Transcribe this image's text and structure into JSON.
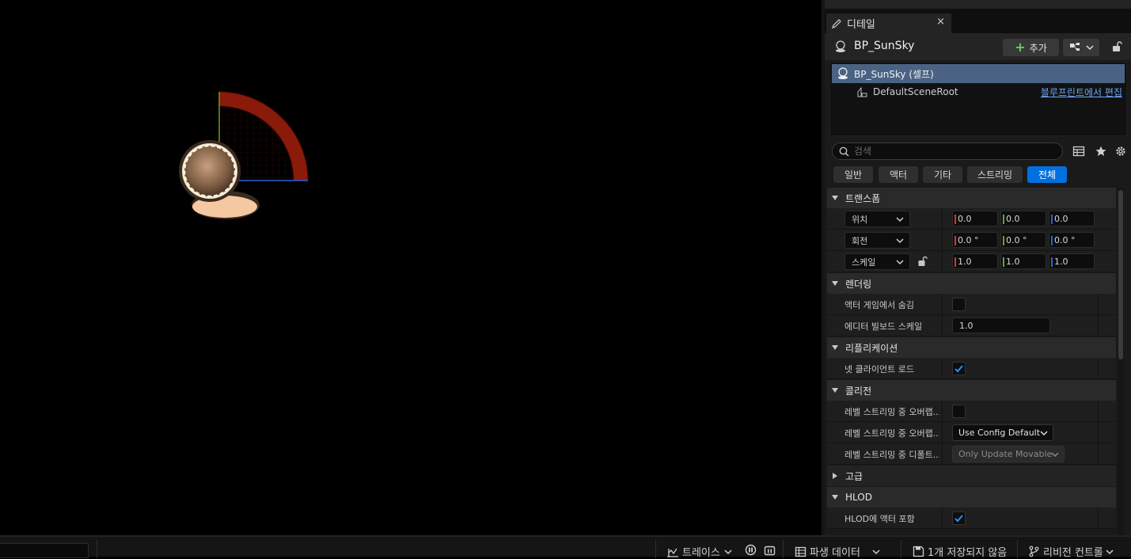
{
  "details_panel": {
    "tab_label": "디테일",
    "close_glyph": "×",
    "actor_name": "BP_SunSky",
    "add_button_label": "추가",
    "add_button_plus": "+",
    "tree": {
      "root_label": "BP_SunSky (셀프)",
      "child_label": "DefaultSceneRoot",
      "edit_link": "블루프린트에서 편집"
    },
    "search_placeholder": "검색",
    "filters": [
      "일반",
      "액터",
      "기타",
      "스트리밍",
      "전체"
    ],
    "active_filter": "전체",
    "categories": {
      "transform": "트랜스폼",
      "rendering": "렌더링",
      "replication": "리플리케이션",
      "collision": "콜리전",
      "advanced": "고급",
      "hlod": "HLOD"
    },
    "transform": {
      "location": {
        "label": "위치",
        "x": "0.0",
        "y": "0.0",
        "z": "0.0"
      },
      "rotation": {
        "label": "회전",
        "x": "0.0 °",
        "y": "0.0 °",
        "z": "0.0 °"
      },
      "scale": {
        "label": "스케일",
        "x": "1.0",
        "y": "1.0",
        "z": "1.0"
      }
    },
    "rendering": {
      "hide_in_game_label": "액터 게임에서 숨김",
      "hide_in_game_checked": false,
      "billboard_scale_label": "에디터 빌보드 스케일",
      "billboard_scale_value": "1.0"
    },
    "replication": {
      "net_load_label": "넷 클라이언트 로드",
      "net_load_checked": true
    },
    "collision": {
      "row1_label": "레벨 스트리밍 중 오버랩...",
      "row1_checked": false,
      "row2_label": "레벨 스트리밍 중 오버랩...",
      "row2_value": "Use Config Default",
      "row3_label": "레벨 스트리밍 중 디폴트...",
      "row3_value": "Only Update Movable"
    },
    "hlod": {
      "include_label": "HLOD에 액터 포함",
      "include_checked": true
    }
  },
  "status_bar": {
    "trace_label": "트레이스",
    "derived_data_label": "파생 데이터",
    "unsaved_label": "1개 저장되지 않음",
    "revision_label": "리비전 컨트롤"
  },
  "icons": {
    "tab": "pencil-icon",
    "actor": "sun-sky-actor-icon",
    "scene_root": "scene-component-icon",
    "search": "search-icon",
    "table": "table-view-icon",
    "favorite": "star-icon",
    "settings": "gear-icon"
  },
  "colors": {
    "accent": "#0070e0",
    "selection": "#4a6385",
    "axis_x": "#d53a2a",
    "axis_y": "#60a82a",
    "axis_z": "#2a63d5",
    "link": "#6aa8ff",
    "gizmo_arc": "#8a1a0a"
  }
}
